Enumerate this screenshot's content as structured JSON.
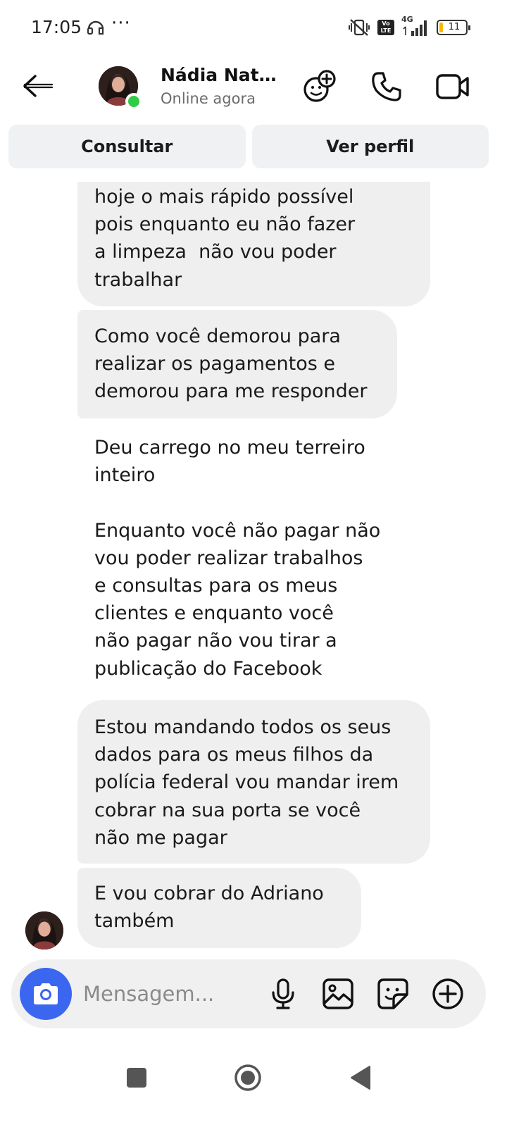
{
  "status_bar": {
    "time": "17:05",
    "dots": "···",
    "volte": "Vo LTE",
    "network": "4G",
    "battery": "11"
  },
  "header": {
    "name": "Nádia Nat…",
    "status": "Online agora"
  },
  "actions": {
    "consult": "Consultar",
    "profile": "Ver perfil"
  },
  "messages": [
    {
      "lines": [
        "hoje o mais rápido possível",
        "pois enquanto eu não fazer",
        "a limpeza  não vou poder",
        "trabalhar"
      ]
    },
    {
      "lines": [
        "Como você demorou para",
        "realizar os pagamentos e",
        "demorou para me responder"
      ]
    },
    {
      "lines": [
        "Deu carrego no meu terreiro",
        "inteiro",
        "",
        "Enquanto você não pagar não",
        "vou poder realizar trabalhos",
        "e consultas para os meus",
        "clientes e enquanto você",
        "não pagar não vou tirar a",
        "publicação do Facebook"
      ]
    },
    {
      "lines": [
        "Estou mandando todos os seus",
        "dados para os meus filhos da",
        "polícia federal vou mandar irem",
        "cobrar na sua porta se você",
        "não me pagar"
      ]
    },
    {
      "lines": [
        "E vou cobrar do Adriano",
        "também"
      ]
    }
  ],
  "composer": {
    "placeholder": "Mensagem..."
  },
  "colors": {
    "accent": "#3a66f0",
    "online": "#31cc46",
    "bubble": "#efefef",
    "battery_low": "#f5b800"
  },
  "icons": {
    "back": "arrow-left-icon",
    "add_people": "add-people-icon",
    "call": "phone-icon",
    "video": "video-camera-icon",
    "camera": "camera-icon",
    "mic": "microphone-icon",
    "gallery": "image-icon",
    "sticker": "sticker-icon",
    "add": "plus-circle-icon"
  }
}
